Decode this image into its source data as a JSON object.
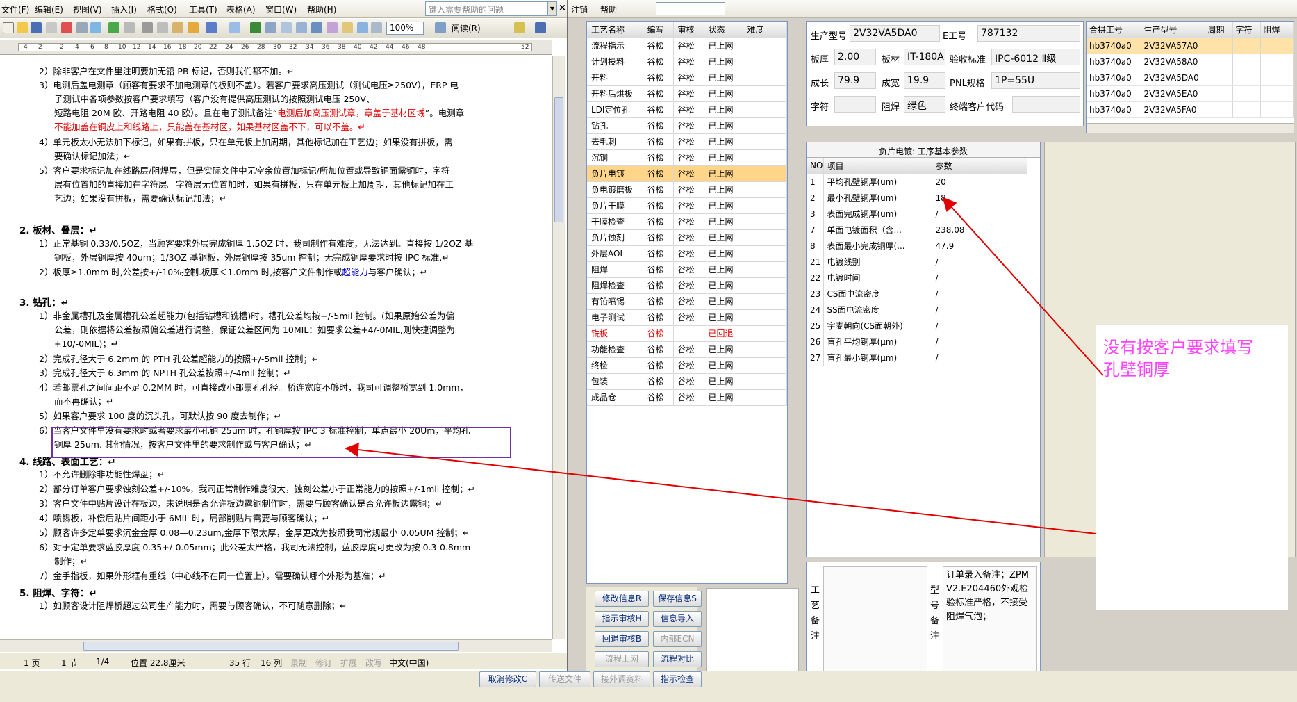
{
  "word": {
    "menu": [
      "文件(F)",
      "编辑(E)",
      "视图(V)",
      "插入(I)",
      "格式(O)",
      "工具(T)",
      "表格(A)",
      "窗口(W)",
      "帮助(H)"
    ],
    "help_placeholder": "键入需要帮助的问题",
    "close_glyph": "×",
    "zoom": "100%",
    "read_label": "阅读(R)",
    "ruler_ticks": [
      "4",
      "2",
      "2",
      "4",
      "6",
      "8",
      "10",
      "12",
      "14",
      "16",
      "18",
      "20",
      "22",
      "24",
      "26",
      "28",
      "30",
      "32",
      "34",
      "36",
      "38",
      "40",
      "42",
      "44",
      "46",
      "48",
      "52"
    ],
    "lines": {
      "l1": "2）除非客户在文件里注明要加无铅 PB 标记，否则我们都不加。↵",
      "l2": "3）电测后盖电测章（顾客有要求不加电测章的板则不盖）。若客户要求高压测试（测试电压≥250V），ERP 电",
      "l3": "子测试中各项参数按客户要求填写（客户没有提供高压测试的按照测试电压 250V、",
      "l4a": "短路电阻 20M 欧、开路电阻 40 欧）。且在电子测试备注“",
      "l4b": "电测后加高压测试章，章盖于基材区域",
      "l4c": "”。电测章",
      "l5": "不能加盖在铜皮上和线路上，只能盖在基材区，如果基材区盖不下，可以不盖。↵",
      "l6": "4）单元板太小无法加下标记，如果有拼板，只在单元板上加周期，其他标记加在工艺边；如果没有拼板，需",
      "l7": "要确认标记加法；↵",
      "l8": "5）客户要求标记加在线路层/阻焊层，但是实际文件中无空余位置加标记/所加位置或导致铜面露铜时，字符",
      "l9": "层有位置加的直接加在字符层。字符层无位置加时，如果有拼板，只在单元板上加周期，其他标记加在工",
      "l10": "艺边；如果没有拼板，需要确认标记加法；↵",
      "h2": "2.   板材、叠层：↵",
      "l11": "1）正常基铜 0.33/0.5OZ，当顾客要求外层完成铜厚 1.5OZ 时，我司制作有难度，无法达到。直接按 1/2OZ 基",
      "l12": "铜板，外层铜厚按 40um；1/3OZ 基铜板，外层铜厚按 35um 控制；无完成铜厚要求时按 IPC 标准.↵",
      "l13a": "2）板厚≥1.0mm 时,公差按+/-10%控制.板厚＜1.0mm 时,按客户文件制作或",
      "l13b": "超能力",
      "l13c": "与客户确认；↵",
      "h3": "3.   钻孔：↵",
      "l14": "1）非金属槽孔及金属槽孔公差超能力(包括钻槽和铣槽)时，槽孔公差均按+/-5mil 控制。(如果原始公差为偏",
      "l15": "公差，则依据将公差按照偏公差进行调整，保证公差区间为 10MIL：如要求公差+4/-0MIL,则快捷调整为",
      "l16": "+10/-0MIL)；↵",
      "l17": "2）完成孔径大于 6.2mm 的 PTH 孔公差超能力的按照+/-5mil 控制；↵",
      "l18": "3）完成孔径大于 6.3mm 的 NPTH 孔公差按照+/-4mil 控制；↵",
      "l19": "4）若邮票孔之间间距不足 0.2MM 时，可直接改小邮票孔孔径。桥连宽度不够时，我司可调整桥宽到 1.0mm，",
      "l20": "而不再确认；↵",
      "l21": "5）如果客户要求 100 度的沉头孔，可默认按 90 度去制作；↵",
      "l22": "6）当客户文件里没有要求时或者要求最小孔铜 25um 时，孔铜厚按 IPC 3 标准控制，单点最小 20Um，平均孔",
      "l23": "铜厚 25um. 其他情况，按客户文件里的要求制作或与客户确认；↵",
      "h4": "4.   线路、表面工艺：↵",
      "l24": "1）不允许删除非功能性焊盘；↵",
      "l25": "2）部分订单客户要求蚀刻公差+/-10%，我司正常制作难度很大，蚀刻公差小于正常能力的按照+/-1mil 控制；↵",
      "l26": "3）客户文件中贴片设计在板边，未说明是否允许板边露铜制作时，需要与顾客确认是否允许板边露铜；↵",
      "l27": "4）喷锡板，补偿后贴片间距小于 6MIL 时，局部削贴片需要与顾客确认；↵",
      "l28": "5）顾客许多定单要求沉金金厚 0.08—0.23um,金厚下限太厚，金厚更改为按照我司常规最小 0.05UM 控制；↵",
      "l29": "6）对于定单要求蓝胶厚度 0.35+/-0.05mm；此公差太严格，我司无法控制，蓝胶厚度可更改为按 0.3-0.8mm",
      "l30": "制作；↵",
      "l31": "7）金手指板，如果外形框有重线（中心线不在同一位置上），需要确认哪个外形为基准；↵",
      "h5": "5.   阻焊、字符：↵",
      "l32": "1）如顾客设计阻焊桥超过公司生产能力时，需要与顾客确认，不可随意删除；↵"
    },
    "status": {
      "page": "1 页",
      "section": "1 节",
      "pages": "1/4",
      "position": "位置 22.8厘米",
      "row": "35 行",
      "col": "16 列",
      "rec": "录制",
      "trk": "修订",
      "ext": "扩展",
      "ovr": "改写",
      "lang": "中文(中国)"
    }
  },
  "app": {
    "topbar": {
      "annotate": "注销",
      "help": "帮助"
    },
    "process_table": {
      "headers": [
        "工艺名称",
        "编写",
        "审核",
        "状态",
        "难度"
      ],
      "rows": [
        [
          "流程指示",
          "谷松",
          "谷松",
          "已上网",
          ""
        ],
        [
          "计划投料",
          "谷松",
          "谷松",
          "已上网",
          ""
        ],
        [
          "开料",
          "谷松",
          "谷松",
          "已上网",
          ""
        ],
        [
          "开料后烘板",
          "谷松",
          "谷松",
          "已上网",
          ""
        ],
        [
          "LDI定位孔",
          "谷松",
          "谷松",
          "已上网",
          ""
        ],
        [
          "钻孔",
          "谷松",
          "谷松",
          "已上网",
          ""
        ],
        [
          "去毛刺",
          "谷松",
          "谷松",
          "已上网",
          ""
        ],
        [
          "沉铜",
          "谷松",
          "谷松",
          "已上网",
          ""
        ],
        [
          "负片电镀",
          "谷松",
          "谷松",
          "已上网",
          ""
        ],
        [
          "负电镀磨板",
          "谷松",
          "谷松",
          "已上网",
          ""
        ],
        [
          "负片干膜",
          "谷松",
          "谷松",
          "已上网",
          ""
        ],
        [
          "干膜检查",
          "谷松",
          "谷松",
          "已上网",
          ""
        ],
        [
          "负片蚀刻",
          "谷松",
          "谷松",
          "已上网",
          ""
        ],
        [
          "外层AOI",
          "谷松",
          "谷松",
          "已上网",
          ""
        ],
        [
          "阻焊",
          "谷松",
          "谷松",
          "已上网",
          ""
        ],
        [
          "阻焊检查",
          "谷松",
          "谷松",
          "已上网",
          ""
        ],
        [
          "有铅喷锡",
          "谷松",
          "谷松",
          "已上网",
          ""
        ],
        [
          "电子测试",
          "谷松",
          "谷松",
          "已上网",
          ""
        ],
        [
          "铣板",
          "谷松",
          "",
          "已回退",
          ""
        ],
        [
          "功能检查",
          "谷松",
          "谷松",
          "已上网",
          ""
        ],
        [
          "终检",
          "谷松",
          "谷松",
          "已上网",
          ""
        ],
        [
          "包装",
          "谷松",
          "谷松",
          "已上网",
          ""
        ],
        [
          "成品仓",
          "谷松",
          "谷松",
          "已上网",
          ""
        ]
      ]
    },
    "info": {
      "model_label": "生产型号",
      "model": "2V32VA5DA0",
      "eno_label": "E工号",
      "eno": "787132",
      "thick_label": "板厚",
      "thick": "2.00",
      "mat_label": "板材",
      "mat": "IT-180A",
      "std_label": "验收标准",
      "std": "IPC-6012 Ⅱ级",
      "len_label": "成长",
      "len": "79.9",
      "wid_label": "成宽",
      "wid": "19.9",
      "pnl_label": "PNL规格",
      "pnl": "1P=55U",
      "char_label": "字符",
      "char": "",
      "mask_label": "阻焊",
      "mask": "绿色",
      "cust_label": "终端客户代码",
      "cust": ""
    },
    "order_table": {
      "headers": [
        "合拼工号",
        "生产型号",
        "周期",
        "字符",
        "阻焊"
      ],
      "rows": [
        [
          "hb3740a0",
          "2V32VA57A0"
        ],
        [
          "hb3740a0",
          "2V32VA58A0"
        ],
        [
          "hb3740a0",
          "2V32VA5DA0"
        ],
        [
          "hb3740a0",
          "2V32VA5EA0"
        ],
        [
          "hb3740a0",
          "2V32VA5FA0"
        ]
      ]
    },
    "param": {
      "title": "负片电镀: 工序基本参数",
      "headers": [
        "NO",
        "项目",
        "参数"
      ],
      "rows": [
        [
          "1",
          "平均孔壁铜厚(um)",
          "20"
        ],
        [
          "2",
          "最小孔壁铜厚(um)",
          "18"
        ],
        [
          "3",
          "表面完成铜厚(um)",
          "/"
        ],
        [
          "7",
          "单面电镀面积（含...",
          "238.08"
        ],
        [
          "8",
          "表面最小完成铜厚(...",
          "47.9"
        ],
        [
          "21",
          "电镀线别",
          "/"
        ],
        [
          "22",
          "电镀时间",
          "/"
        ],
        [
          "23",
          "CS面电流密度",
          "/"
        ],
        [
          "24",
          "SS面电流密度",
          "/"
        ],
        [
          "25",
          "字麦朝向(CS面朝外)",
          "/"
        ],
        [
          "26",
          "盲孔平均铜厚(μm)",
          "/"
        ],
        [
          "27",
          "盲孔最小铜厚(μm)",
          "/"
        ]
      ]
    },
    "note": {
      "proc_label": "工艺备注",
      "model_label": "型号备注",
      "model_text": "订单录入备注；ZPMV2.E204460外观检验标准严格，不接受阻焊气泡；"
    },
    "annotation": {
      "line1": "没有按客户要求填写",
      "line2": "孔壁铜厚"
    },
    "buttons": {
      "modify_info": "修改信息R",
      "save_info": "保存信息S",
      "guide_review": "指示审核H",
      "info_import": "信息导入",
      "back_review": "回退审核B",
      "internal_ecn": "内部ECN",
      "flow_online": "流程上网",
      "flow_compare": "流程对比",
      "cancel_modify": "取消修改C",
      "send_file": "传送文件",
      "receive_data": "接外调资料",
      "guide_check": "指示检查"
    }
  }
}
